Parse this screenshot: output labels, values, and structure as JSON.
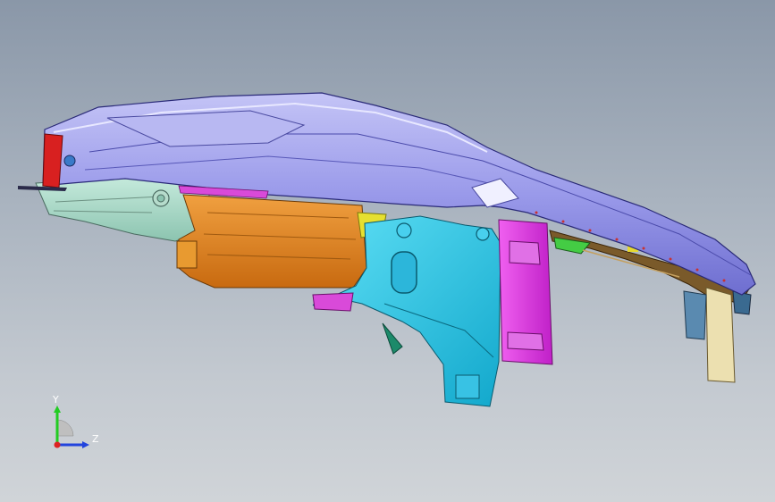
{
  "viewport": {
    "background_top": "#8a97a8",
    "background_bottom": "#d0d4d8"
  },
  "triad": {
    "y_label": "Y",
    "z_label": "Z",
    "colors": {
      "y_axis": "#22cc22",
      "z_axis": "#2244dd",
      "x_axis": "#dd2222"
    }
  },
  "parts": {
    "roof_rail_color": "#8f8fe6",
    "front_pillar_color": "#a8dcc8",
    "orange_panel_color": "#e0861c",
    "cyan_panel_color": "#1ec4e6",
    "magenta_bracket_color": "#dd33dd",
    "rear_panel_color": "#6a4e26",
    "tan_bracket_color": "#e8dca8"
  }
}
